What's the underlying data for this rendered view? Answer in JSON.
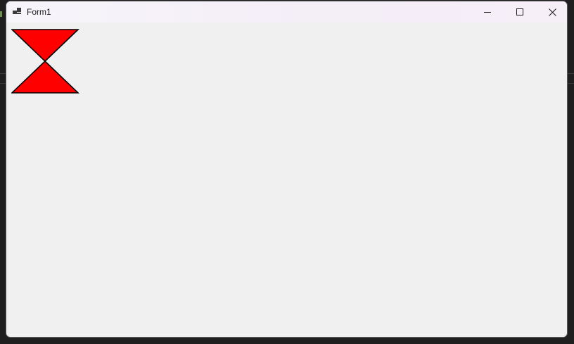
{
  "window": {
    "title": "Form1",
    "icon": "form-app-icon",
    "controls": {
      "minimize_icon": "minimize-icon",
      "maximize_icon": "maximize-icon",
      "close_icon": "close-icon"
    }
  },
  "canvas": {
    "shape": "hourglass",
    "fill_color": "#ff0000",
    "stroke_color": "#000000"
  }
}
